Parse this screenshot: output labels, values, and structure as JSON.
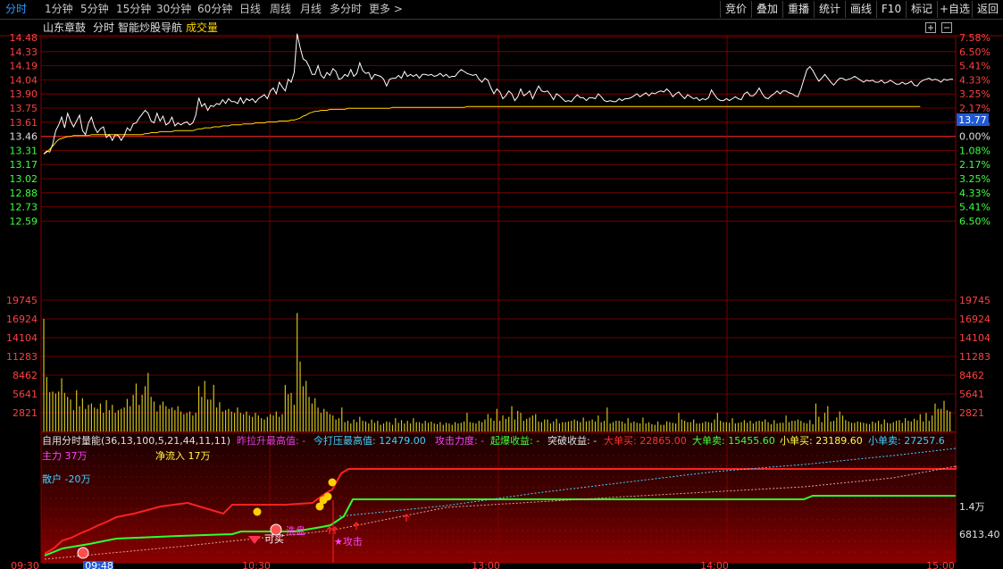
{
  "toolbar": {
    "tabs": [
      {
        "label": "分时",
        "active": true
      },
      {
        "label": "1分钟"
      },
      {
        "label": "5分钟"
      },
      {
        "label": "15分钟"
      },
      {
        "label": "30分钟"
      },
      {
        "label": "60分钟"
      },
      {
        "label": "日线"
      },
      {
        "label": "周线"
      },
      {
        "label": "月线"
      },
      {
        "label": "多分时"
      },
      {
        "label": "更多 >"
      }
    ],
    "right_buttons": [
      "竞价",
      "叠加",
      "重播",
      "统计",
      "画线",
      "F10",
      "标记",
      "+自选",
      "返回"
    ]
  },
  "header": {
    "stock": "山东章鼓",
    "mode": "分时",
    "indicator": "智能炒股导航",
    "volume": "成交量"
  },
  "price_axis": {
    "left": [
      "14.48",
      "14.33",
      "14.19",
      "14.04",
      "13.90",
      "13.75",
      "13.61",
      "13.46",
      "13.31",
      "13.17",
      "13.02",
      "12.88",
      "12.73",
      "12.59"
    ],
    "right": [
      "7.58%",
      "6.50%",
      "5.41%",
      "4.33%",
      "3.25%",
      "2.17%",
      "1.08%",
      "0.00%",
      "1.08%",
      "2.17%",
      "3.25%",
      "4.33%",
      "5.41%",
      "6.50%"
    ],
    "current_price": "13.77"
  },
  "volume_axis": [
    "19745",
    "16924",
    "14104",
    "11283",
    "8462",
    "5641",
    "2821"
  ],
  "indicator_panel": {
    "title": "自用分时量能(36,13,100,5,21,44,11,11)",
    "fields": [
      {
        "text": "昨拉升最高值: -",
        "color": "#e040e0"
      },
      {
        "text": "今打压最高值: 12479.00",
        "color": "#40d0ff"
      },
      {
        "text": "攻击力度: -",
        "color": "#ff40ff"
      },
      {
        "text": "起爆收益: -",
        "color": "#40ff40"
      },
      {
        "text": "突破收益: -",
        "color": "#e0e0e0"
      },
      {
        "text": "大单买: 22865.00",
        "color": "#ff3030"
      },
      {
        "text": "大单卖: 15455.60",
        "color": "#40ff40"
      },
      {
        "text": "小单买: 23189.60",
        "color": "#ffff40"
      },
      {
        "text": "小单卖: 27257.6",
        "color": "#40d0ff"
      }
    ],
    "main_force": "主力 37万",
    "net_inflow": "净流入 17万",
    "retail": "散户 -20万",
    "axis_top": "1.4万",
    "axis_bottom": "6813.40",
    "annotations": {
      "buy": "可买",
      "wash": "洗盘",
      "attack": "★攻击"
    }
  },
  "time_axis": [
    "09:30",
    "09:48",
    "10:30",
    "13:00",
    "14:00",
    "15:00"
  ],
  "colors": {
    "price_line": "#ffffff",
    "avg_line": "#ffd700",
    "grid": "#8b0000",
    "up": "#ff3030",
    "down": "#30ff30"
  },
  "chart_data": {
    "type": "line",
    "prev_close": 13.46,
    "ylim": [
      12.59,
      14.48
    ],
    "series": [
      {
        "values": [
          13.28,
          13.31,
          13.3,
          13.38,
          13.52,
          13.58,
          13.66,
          13.55,
          13.7,
          13.62,
          13.56,
          13.62,
          13.68,
          13.52,
          13.48,
          13.6,
          13.66,
          13.56,
          13.5,
          13.54,
          13.56,
          13.45,
          13.48,
          13.42,
          13.48,
          13.47,
          13.42,
          13.47,
          13.55,
          13.52,
          13.59,
          13.6,
          13.65,
          13.69,
          13.73,
          13.7,
          13.62,
          13.6,
          13.7,
          13.62,
          13.67,
          13.58,
          13.6,
          13.66,
          13.57,
          13.6,
          13.58,
          13.6,
          13.61,
          13.58,
          13.6,
          13.68,
          13.86,
          13.77,
          13.8,
          13.73,
          13.78,
          13.77,
          13.8,
          13.79,
          13.84,
          13.8,
          13.85,
          13.82,
          13.82,
          13.8,
          13.86,
          13.8,
          13.85,
          13.83,
          13.85,
          13.81,
          13.85,
          13.87,
          13.89,
          13.85,
          13.93,
          13.96,
          13.9,
          14.02,
          13.97,
          13.93,
          14.05,
          14.02,
          14.12,
          14.52,
          14.38,
          14.26,
          14.24,
          14.18,
          14.1,
          14.1,
          14.19,
          14.09,
          14.06,
          14.12,
          14.09,
          14.16,
          14.13,
          14.05,
          14.06,
          14.1,
          14.08,
          14.15,
          14.08,
          14.11,
          14.22,
          14.14,
          14.11,
          14.12,
          14.05,
          14.1,
          14.09,
          14.08,
          14.05,
          13.98,
          14.05,
          14.06,
          14.06,
          14.09,
          14.06,
          14.13,
          14.08,
          14.1,
          14.08,
          14.1,
          14.06,
          14.1,
          14.1,
          14.09,
          14.1,
          14.08,
          14.09,
          14.11,
          14.08,
          14.1,
          14.07,
          14.08,
          14.08,
          14.12,
          14.15,
          14.13,
          14.11,
          14.1,
          14.09,
          14.1,
          14.05,
          14.02,
          14.06,
          14.04,
          13.96,
          13.9,
          13.95,
          13.92,
          13.85,
          13.88,
          13.93,
          13.9,
          13.83,
          13.87,
          13.95,
          13.88,
          13.9,
          13.93,
          13.85,
          13.92,
          13.98,
          13.93,
          13.92,
          13.93,
          13.89,
          13.84,
          13.9,
          13.88,
          13.85,
          13.82,
          13.83,
          13.82,
          13.86,
          13.89,
          13.86,
          13.86,
          13.83,
          13.86,
          13.86,
          13.85,
          13.9,
          13.87,
          13.83,
          13.82,
          13.83,
          13.82,
          13.82,
          13.85,
          13.83,
          13.85,
          13.85,
          13.86,
          13.88,
          13.9,
          13.87,
          13.89,
          13.91,
          13.88,
          13.91,
          13.9,
          13.92,
          13.93,
          13.92,
          13.95,
          13.92,
          13.87,
          13.9,
          13.92,
          13.88,
          13.85,
          13.89,
          13.87,
          13.85,
          13.86,
          13.83,
          13.85,
          13.84,
          13.86,
          13.94,
          13.89,
          13.85,
          13.83,
          13.83,
          13.85,
          13.83,
          13.85,
          13.87,
          13.85,
          13.84,
          13.9,
          13.92,
          13.88,
          13.88,
          13.91,
          13.96,
          13.9,
          13.86,
          13.85,
          13.88,
          13.9,
          13.93,
          13.9,
          13.93,
          13.93,
          13.91,
          13.9,
          13.88,
          13.87,
          13.95,
          14.05,
          14.15,
          14.18,
          14.14,
          14.08,
          14.03,
          14.06,
          14.1,
          14.06,
          14.02,
          13.99,
          14.03,
          14.06,
          14.06,
          14.04,
          14.05,
          14.06,
          14.08,
          14.06,
          14.04,
          14.02,
          14.04,
          14.03,
          14.04,
          14.02,
          14.02,
          14.04,
          14.01,
          14.02,
          14.04,
          14.02,
          14.0,
          14.0,
          14.02,
          14.0,
          14.01,
          14.03,
          13.99,
          13.98,
          14.02,
          14.04,
          14.05,
          14.06,
          14.04,
          14.05,
          14.04,
          14.02,
          14.05,
          14.04,
          14.05,
          14.05
        ]
      },
      {
        "values": [
          13.28,
          13.3,
          13.33,
          13.36,
          13.4,
          13.43,
          13.44,
          13.45,
          13.46,
          13.46,
          13.47,
          13.47,
          13.47,
          13.47,
          13.47,
          13.47,
          13.48,
          13.48,
          13.48,
          13.48,
          13.48,
          13.48,
          13.48,
          13.48,
          13.48,
          13.48,
          13.48,
          13.48,
          13.48,
          13.48,
          13.48,
          13.48,
          13.48,
          13.48,
          13.49,
          13.49,
          13.5,
          13.5,
          13.5,
          13.51,
          13.51,
          13.51,
          13.51,
          13.51,
          13.52,
          13.52,
          13.52,
          13.52,
          13.52,
          13.52,
          13.52,
          13.53,
          13.54,
          13.54,
          13.55,
          13.55,
          13.55,
          13.56,
          13.56,
          13.56,
          13.57,
          13.57,
          13.57,
          13.58,
          13.58,
          13.58,
          13.58,
          13.59,
          13.59,
          13.59,
          13.59,
          13.6,
          13.6,
          13.6,
          13.6,
          13.61,
          13.61,
          13.61,
          13.61,
          13.62,
          13.62,
          13.62,
          13.62,
          13.63,
          13.63,
          13.64,
          13.65,
          13.67,
          13.68,
          13.7,
          13.71,
          13.72,
          13.72,
          13.73,
          13.73,
          13.73,
          13.74,
          13.74,
          13.74,
          13.74,
          13.74,
          13.74,
          13.75,
          13.75,
          13.75,
          13.75,
          13.75,
          13.75,
          13.75,
          13.75,
          13.75,
          13.75,
          13.75,
          13.75,
          13.75,
          13.75,
          13.75,
          13.76,
          13.76,
          13.76,
          13.76,
          13.76,
          13.76,
          13.76,
          13.76,
          13.76,
          13.76,
          13.76,
          13.76,
          13.76,
          13.76,
          13.76,
          13.76,
          13.76,
          13.76,
          13.76,
          13.76,
          13.76,
          13.76,
          13.76,
          13.76,
          13.76,
          13.77,
          13.77,
          13.77,
          13.77,
          13.77,
          13.77,
          13.77,
          13.77,
          13.77,
          13.77,
          13.77,
          13.77,
          13.77,
          13.77,
          13.77,
          13.77,
          13.77,
          13.77,
          13.77,
          13.77,
          13.77,
          13.77,
          13.77,
          13.77,
          13.77,
          13.77,
          13.77,
          13.77,
          13.77,
          13.77,
          13.77,
          13.77,
          13.77,
          13.77,
          13.77,
          13.77,
          13.77,
          13.77,
          13.77,
          13.77,
          13.77,
          13.77,
          13.77,
          13.77,
          13.77,
          13.77,
          13.77,
          13.77,
          13.77,
          13.77,
          13.77,
          13.77,
          13.77,
          13.77,
          13.77,
          13.77,
          13.77,
          13.77,
          13.77,
          13.77,
          13.77,
          13.77,
          13.77,
          13.77,
          13.77,
          13.77,
          13.77,
          13.77,
          13.77,
          13.77,
          13.77,
          13.77,
          13.77,
          13.77,
          13.77,
          13.77,
          13.77,
          13.77,
          13.77,
          13.77,
          13.77,
          13.77,
          13.77,
          13.77,
          13.77,
          13.77,
          13.77,
          13.77,
          13.77,
          13.77,
          13.77,
          13.77,
          13.77,
          13.77,
          13.77,
          13.77,
          13.77,
          13.77,
          13.77,
          13.77,
          13.77,
          13.77,
          13.77,
          13.77,
          13.77,
          13.77,
          13.77,
          13.77,
          13.77,
          13.77,
          13.77,
          13.77,
          13.77,
          13.77,
          13.77,
          13.77,
          13.77,
          13.77,
          13.77,
          13.77,
          13.77,
          13.77,
          13.77,
          13.77,
          13.77,
          13.77,
          13.77,
          13.77,
          13.77,
          13.77,
          13.77,
          13.77,
          13.77,
          13.77,
          13.77,
          13.77,
          13.77,
          13.77,
          13.77,
          13.77,
          13.77,
          13.77,
          13.77,
          13.77,
          13.77,
          13.77,
          13.77,
          13.77,
          13.77,
          13.77,
          13.77,
          13.77,
          13.77
        ]
      }
    ],
    "volume": [
      16924,
      8200,
      5900,
      6000,
      5700,
      6000,
      8000,
      5800,
      5200,
      4800,
      3200,
      6200,
      3800,
      5000,
      3400,
      4000,
      4200,
      3600,
      3400,
      4200,
      2800,
      4700,
      3200,
      4000,
      2800,
      3200,
      3400,
      3600,
      4900,
      3800,
      5500,
      7200,
      4000,
      5500,
      6800,
      8800,
      5200,
      4500,
      3000,
      4000,
      4500,
      3800,
      3400,
      3600,
      3200,
      3800,
      3000,
      2600,
      2800,
      3000,
      2400,
      2800,
      6800,
      5200,
      7600,
      4800,
      4800,
      7000,
      3600,
      4400,
      3000,
      3200,
      3400,
      3000,
      2800,
      3600,
      2800,
      2600,
      3000,
      2400,
      2200,
      2800,
      2400,
      2000,
      1800,
      2200,
      2600,
      2400,
      3000,
      2200,
      2600,
      7000,
      5600,
      5800,
      4000,
      17800,
      10500,
      6800,
      7600,
      5200,
      4200,
      5000,
      3600,
      2800,
      3400,
      3000,
      2600,
      2400,
      1800,
      2000,
      3600,
      1400,
      1600,
      1200,
      1800,
      1400,
      2200,
      1600,
      1500,
      1200,
      1800,
      1300,
      1600,
      1000,
      1200,
      1500,
      1400,
      1000,
      2000,
      1300,
      1700,
      1200,
      1600,
      1200,
      2000,
      1400,
      1400,
      1200,
      1600,
      1300,
      1500,
      1200,
      1100,
      1400,
      1000,
      1300,
      1200,
      1000,
      1400,
      1200,
      1300,
      1500,
      2800,
      1400,
      1300,
      1200,
      1600,
      1400,
      1800,
      2600,
      2000,
      1600,
      3400,
      1600,
      2400,
      1900,
      2200,
      3800,
      1800,
      3100,
      2800,
      1600,
      1900,
      2100,
      2400,
      2600,
      1500,
      1400,
      1800,
      1800,
      1200,
      1500,
      1900,
      1200,
      1400,
      1400,
      1500,
      1600,
      1800,
      1600,
      1400,
      2100,
      1500,
      1600,
      1800,
      1500,
      2400,
      1400,
      1600,
      3600,
      1200,
      1400,
      1600,
      1600,
      1500,
      1200,
      2000,
      1300,
      1500,
      1300,
      1200,
      2100,
      1200,
      1400,
      1100,
      1000,
      1500,
      1000,
      1000,
      1500,
      1400,
      1300,
      1200,
      2800,
      1800,
      1600,
      1400,
      1400,
      1800,
      1200,
      1200,
      1300,
      1500,
      1400,
      1300,
      1800,
      2800,
      1600,
      1400,
      1400,
      1300,
      2000,
      1200,
      1300,
      1400,
      1700,
      1300,
      1600,
      1200,
      1500,
      1600,
      1500,
      1800,
      1400,
      1100,
      1700,
      1200,
      1300,
      1300,
      2400,
      1400,
      1600,
      1600,
      1800,
      1600,
      1300,
      1200,
      1700,
      1100,
      4200,
      2200,
      1400,
      2800,
      3800,
      1500,
      1600,
      2100,
      3000,
      2400,
      1700,
      1500,
      1300,
      1300,
      1500,
      1400,
      1300,
      1200,
      1100,
      1500,
      1300,
      1600,
      1100,
      1800,
      1300,
      1200,
      1400,
      1600,
      1700,
      1300,
      2000,
      1600,
      1500,
      1900,
      1700,
      2600,
      1500,
      2800,
      1600,
      2400,
      4200,
      3400,
      3400,
      4600,
      3200,
      3000
    ]
  }
}
